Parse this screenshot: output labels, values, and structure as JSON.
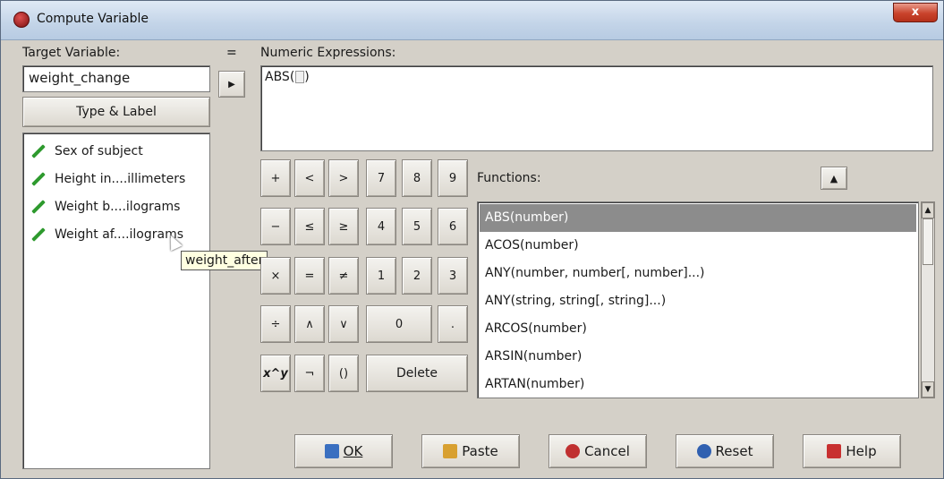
{
  "window": {
    "title": "Compute Variable",
    "close_label": "x"
  },
  "target": {
    "label": "Target Variable:",
    "value": "weight_change",
    "type_label_button": "Type & Label"
  },
  "equals_sign": "=",
  "arrow_button": "▶",
  "expression": {
    "label": "Numeric Expressions:",
    "value": "ABS(",
    "suffix": ")"
  },
  "variables": [
    {
      "label": "Sex of subject"
    },
    {
      "label": "Height in....illimeters"
    },
    {
      "label": "Weight b....ilograms"
    },
    {
      "label": "Weight af....ilograms"
    }
  ],
  "tooltip": "weight_after",
  "keypad": {
    "r1": [
      "+",
      "<",
      ">",
      "7",
      "8",
      "9"
    ],
    "r2": [
      "−",
      "≤",
      "≥",
      "4",
      "5",
      "6"
    ],
    "r3": [
      "×",
      "=",
      "≠",
      "1",
      "2",
      "3"
    ],
    "r4": [
      "÷",
      "∧",
      "∨",
      "0",
      "."
    ],
    "r5": [
      "x^y",
      "¬",
      "()",
      "Delete"
    ]
  },
  "functions": {
    "label": "Functions:",
    "up_icon": "▲",
    "items": [
      "ABS(number)",
      "ACOS(number)",
      "ANY(number, number[, number]...)",
      "ANY(string, string[, string]...)",
      "ARCOS(number)",
      "ARSIN(number)",
      "ARTAN(number)"
    ],
    "selected_index": 0,
    "scroll_up": "▲",
    "scroll_down": "▼"
  },
  "buttons": {
    "ok": {
      "label": "OK",
      "color": "#3a6fc0"
    },
    "paste": {
      "label": "Paste",
      "color": "#d8a030"
    },
    "cancel": {
      "label": "Cancel",
      "color": "#c03030"
    },
    "reset": {
      "label": "Reset",
      "color": "#3060b0"
    },
    "help": {
      "label": "Help",
      "color": "#c83030"
    }
  }
}
